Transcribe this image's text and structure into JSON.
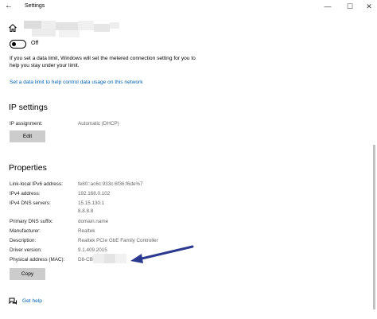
{
  "window": {
    "title": "Settings",
    "back_glyph": "←",
    "minimize_glyph": "—",
    "maximize_glyph": "☐",
    "close_glyph": "✕"
  },
  "metered": {
    "toggle_state": "Off",
    "toggle_on": false,
    "description": "If you set a data limit, Windows will set the metered connection setting for you to help you stay under your limit.",
    "data_limit_link": "Set a data limit to help control data usage on this network"
  },
  "ip_settings": {
    "title": "IP settings",
    "assignment_label": "IP assignment:",
    "assignment_value": "Automatic (DHCP)",
    "edit_label": "Edit"
  },
  "properties": {
    "title": "Properties",
    "rows": [
      {
        "label": "Link-local IPv6 address:",
        "value": "fe80::ac6c:933c:6f36:f6de%7"
      },
      {
        "label": "IPv4 address:",
        "value": "192.168.0.102"
      },
      {
        "label": "IPv4 DNS servers:",
        "value": "15.15.130.1"
      },
      {
        "label": "",
        "value": "8.8.8.8"
      },
      {
        "label": "Primary DNS suffix:",
        "value": "domain.name"
      },
      {
        "label": "Manufacturer:",
        "value": "Realtek"
      },
      {
        "label": "Description:",
        "value": "Realtek PCIe GbE Family Controller"
      },
      {
        "label": "Driver version:",
        "value": "9.1.409.2015"
      },
      {
        "label": "Physical address (MAC):",
        "value": "D8-CB"
      }
    ],
    "copy_label": "Copy"
  },
  "help": {
    "label": "Get help"
  },
  "colors": {
    "link": "#0063b1",
    "button_bg": "#cccccc",
    "arrow": "#2b3a8e"
  }
}
